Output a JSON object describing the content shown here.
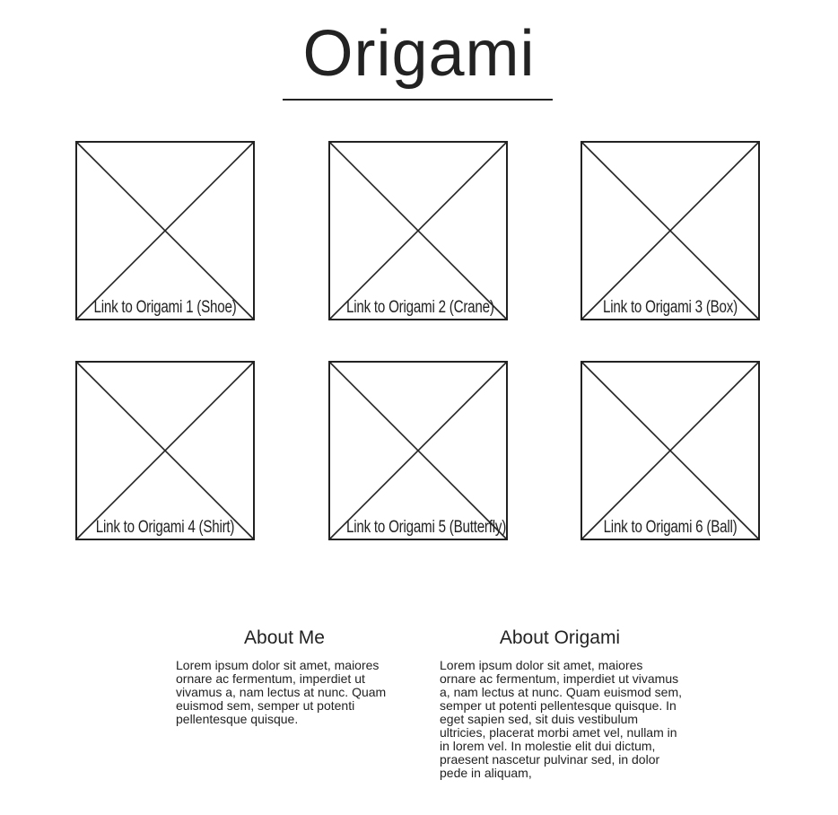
{
  "header": {
    "title": "Origami"
  },
  "gallery": {
    "items": [
      {
        "label": "Link to Origami 1 (Shoe)"
      },
      {
        "label": "Link to Origami 2 (Crane)"
      },
      {
        "label": "Link to Origami 3 (Box)"
      },
      {
        "label": "Link to Origami 4 (Shirt)"
      },
      {
        "label": "Link to Origami 5 (Butterfly)"
      },
      {
        "label": "Link to Origami 6 (Ball)"
      }
    ]
  },
  "about": {
    "me": {
      "heading": "About Me",
      "body": "Lorem ipsum dolor sit amet, maiores ornare ac fermentum, imperdiet ut vivamus a, nam lectus at nunc. Quam euismod sem, semper ut potenti pellentesque quisque."
    },
    "origami": {
      "heading": "About Origami",
      "body": "Lorem ipsum dolor sit amet, maiores ornare ac fermentum, imperdiet ut vivamus a, nam lectus at nunc. Quam euismod sem, semper ut potenti pellentesque quisque. In eget sapien sed, sit duis vestibulum ultricies, placerat morbi amet vel, nullam in in lorem vel. In molestie elit dui dictum, praesent nascetur pulvinar sed, in dolor pede in aliquam,"
    }
  },
  "colors": {
    "ink": "#222222",
    "background": "#ffffff"
  }
}
